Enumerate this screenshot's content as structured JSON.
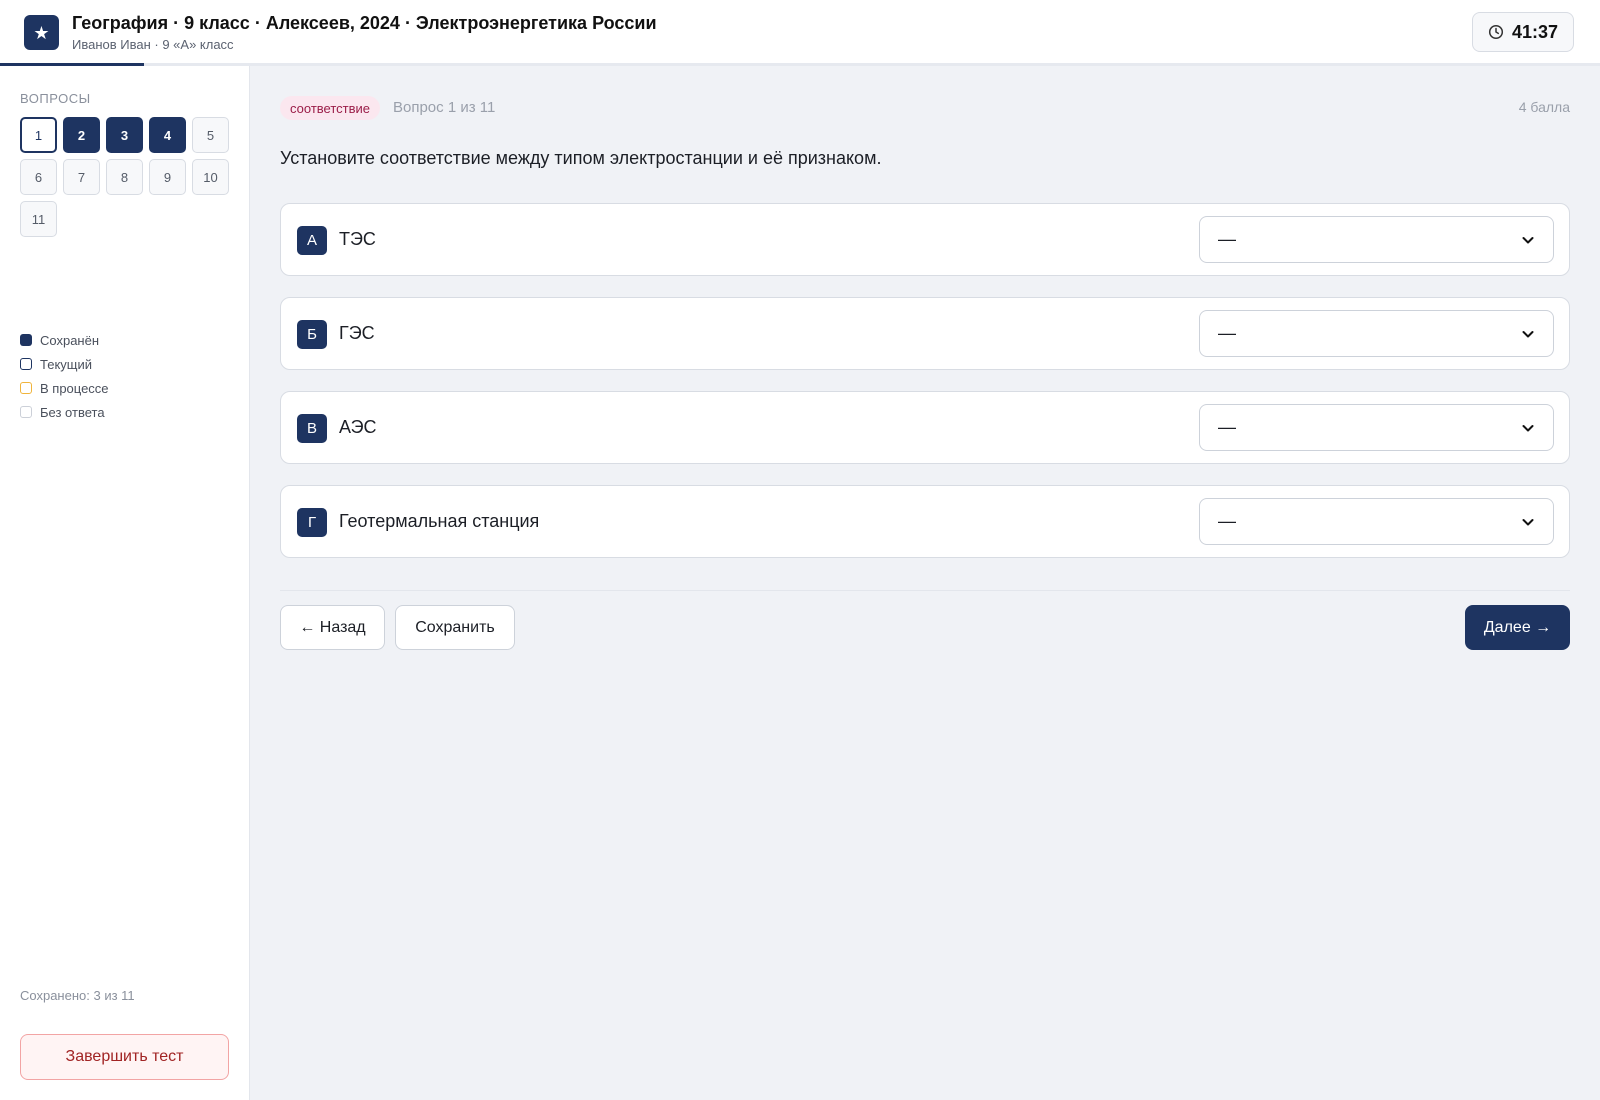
{
  "header": {
    "logo_glyph": "★",
    "title": "География · 9 класс · Алексеев, 2024 · Электроэнергетика России",
    "subtitle": "Иванов Иван · 9 «А» класс",
    "timer": "41:37",
    "progress_fraction": 0.09
  },
  "sidebar": {
    "heading": "ВОПРОСЫ",
    "questions": [
      {
        "number": "1",
        "state": "current"
      },
      {
        "number": "2",
        "state": "saved"
      },
      {
        "number": "3",
        "state": "saved"
      },
      {
        "number": "4",
        "state": "saved"
      },
      {
        "number": "5",
        "state": "unanswered"
      },
      {
        "number": "6",
        "state": "unanswered"
      },
      {
        "number": "7",
        "state": "unanswered"
      },
      {
        "number": "8",
        "state": "unanswered"
      },
      {
        "number": "9",
        "state": "unanswered"
      },
      {
        "number": "10",
        "state": "unanswered"
      },
      {
        "number": "11",
        "state": "unanswered"
      }
    ],
    "legend": {
      "saved": "Сохранён",
      "current": "Текущий",
      "in_progress": "В процессе",
      "unanswered": "Без ответа"
    },
    "saved_count": "Сохранено: 3 из 11",
    "finish_label": "Завершить тест"
  },
  "main": {
    "type_badge": "соответствие",
    "counter": "Вопрос 1 из 11",
    "points": "4 балла",
    "question": "Установите соответствие между типом электростанции и её признаком.",
    "rows": [
      {
        "letter": "А",
        "label": "ТЭС",
        "selected": "—"
      },
      {
        "letter": "Б",
        "label": "ГЭС",
        "selected": "—"
      },
      {
        "letter": "В",
        "label": "АЭС",
        "selected": "—"
      },
      {
        "letter": "Г",
        "label": "Геотермальная станция",
        "selected": "—"
      }
    ],
    "back_label": "← Назад",
    "save_label": "Сохранить",
    "next_label": "Далее →"
  },
  "colors": {
    "accent": "#1e3461",
    "badge_bg": "#fbe7ef",
    "badge_text": "#9b1d48",
    "danger_border": "#f2a4a4",
    "in_progress": "#f0b43c"
  }
}
